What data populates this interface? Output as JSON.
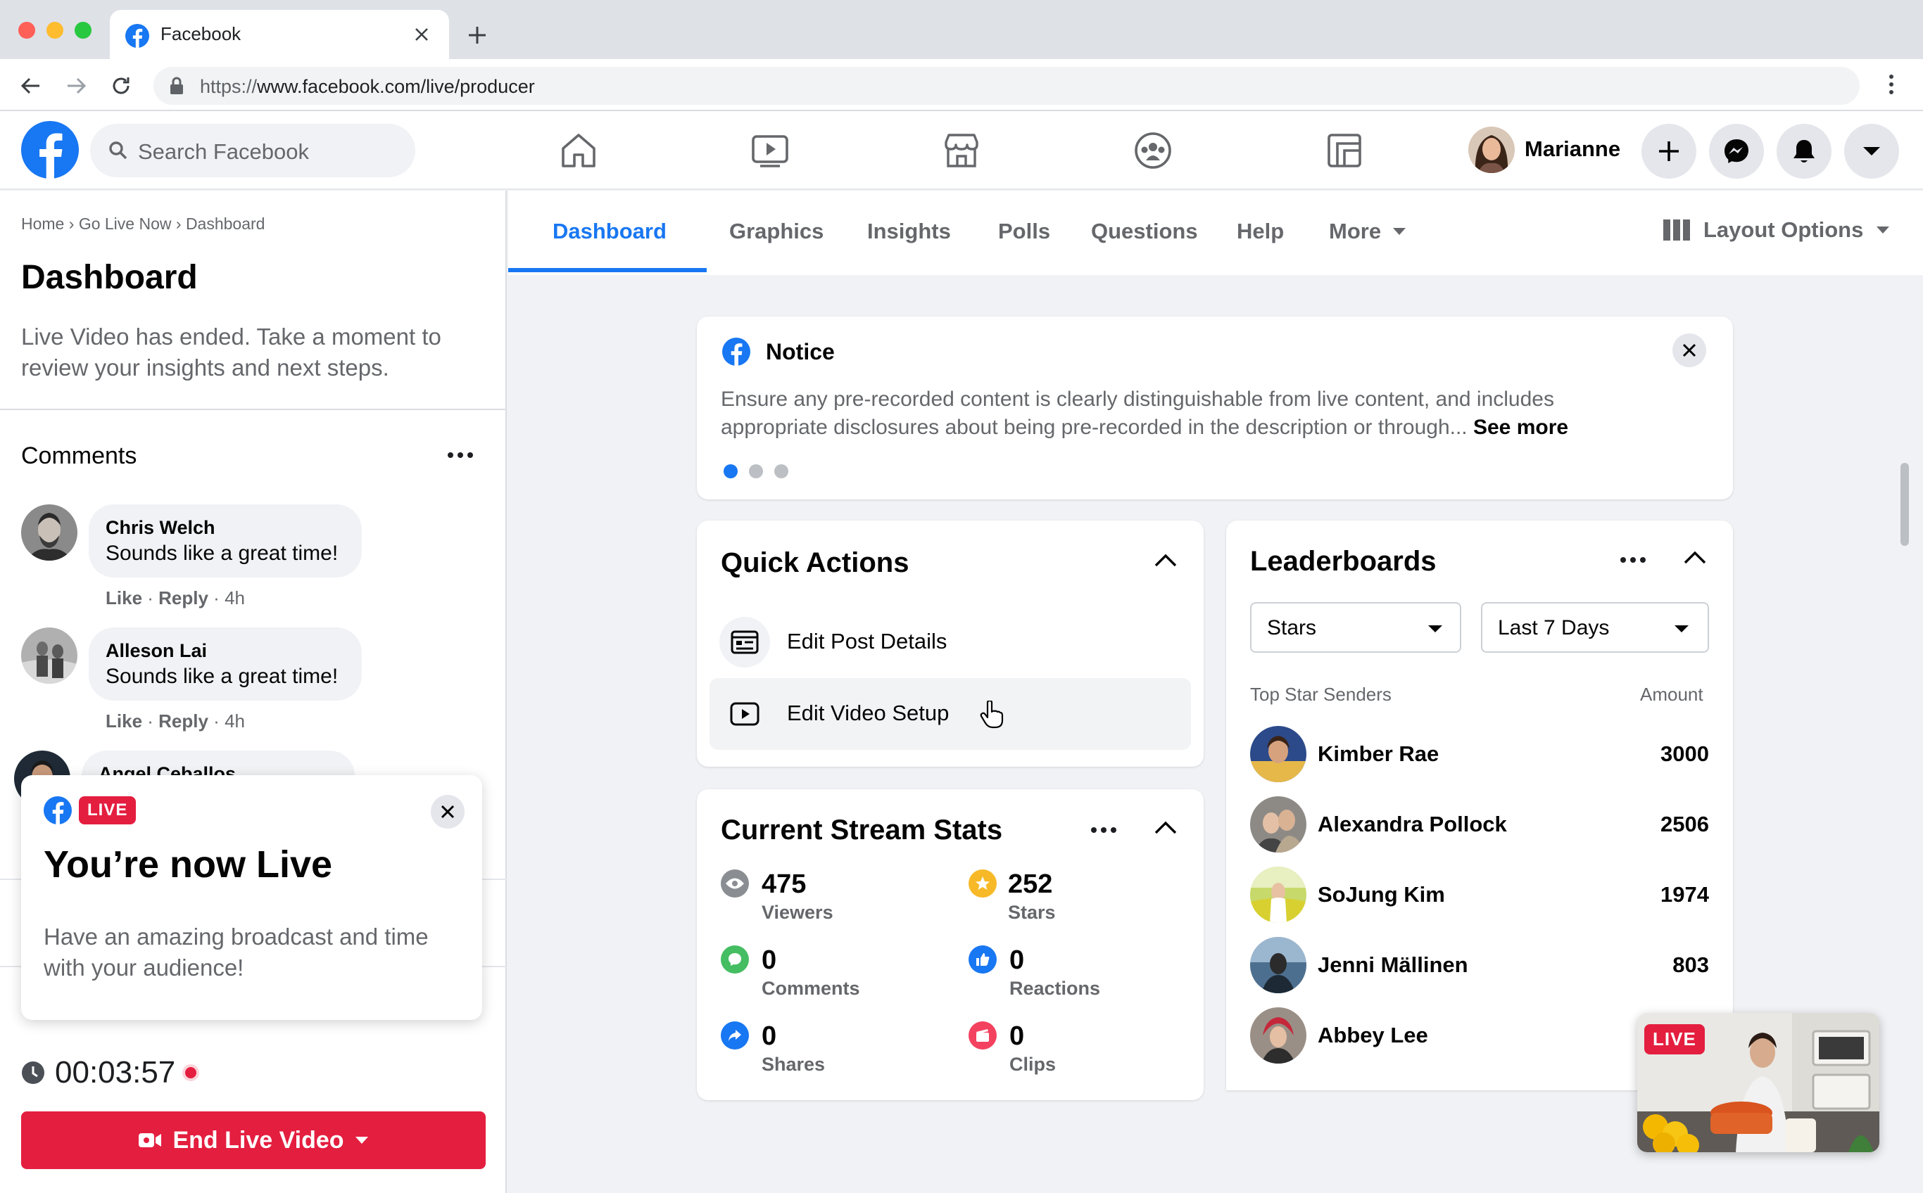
{
  "browser": {
    "tab_title": "Facebook",
    "url_scheme": "https://",
    "url_rest": "www.facebook.com/live/producer",
    "new_tab_icon": "plus-icon",
    "close_tab_icon": "close-icon"
  },
  "fbnav": {
    "search_placeholder": "Search Facebook",
    "user_name": "Marianne",
    "icons": [
      "home-icon",
      "watch-icon",
      "marketplace-icon",
      "groups-icon",
      "gaming-icon"
    ],
    "right_buttons": [
      "create-icon",
      "messenger-icon",
      "notifications-icon",
      "account-menu-icon"
    ]
  },
  "breadcrumb": {
    "home": "Home",
    "sep": "›",
    "go_live": "Go Live Now",
    "current": "Dashboard"
  },
  "left": {
    "title": "Dashboard",
    "description": "Live Video has ended. Take a moment to review your insights and next steps.",
    "comments_title": "Comments",
    "comments": [
      {
        "name": "Chris Welch",
        "text": "Sounds like a great time!",
        "like": "Like",
        "reply": "Reply",
        "time": "4h"
      },
      {
        "name": "Alleson Lai",
        "text": "Sounds like a great time!",
        "like": "Like",
        "reply": "Reply",
        "time": "4h"
      },
      {
        "name": "Angel Ceballos",
        "text": "",
        "like": "",
        "reply": "",
        "time": ""
      }
    ],
    "popup": {
      "badge": "LIVE",
      "title": "You’re now Live",
      "description": "Have an amazing broadcast and time with your audience!"
    },
    "timer": "00:03:57",
    "end_button": "End Live Video"
  },
  "tabs": {
    "items": [
      "Dashboard",
      "Graphics",
      "Insights",
      "Polls",
      "Questions",
      "Help",
      "More"
    ],
    "active": "Dashboard",
    "layout_options": "Layout Options"
  },
  "notice": {
    "title": "Notice",
    "text": "Ensure any pre-recorded content is clearly distinguishable from live content, and includes appropriate disclosures about being pre-recorded in the description or through...",
    "see_more": "See more",
    "pages": 3,
    "active_page": 1
  },
  "quick_actions": {
    "title": "Quick Actions",
    "items": [
      {
        "label": "Edit Post Details",
        "icon": "post-details-icon"
      },
      {
        "label": "Edit Video Setup",
        "icon": "video-setup-icon"
      }
    ]
  },
  "stream_stats": {
    "title": "Current Stream Stats",
    "items": [
      {
        "value": "475",
        "label": "Viewers",
        "icon": "eye-icon",
        "color": "#8a8d91"
      },
      {
        "value": "252",
        "label": "Stars",
        "icon": "star-icon",
        "color": "#f7b928"
      },
      {
        "value": "0",
        "label": "Comments",
        "icon": "comment-icon",
        "color": "#45bd62"
      },
      {
        "value": "0",
        "label": "Reactions",
        "icon": "like-icon",
        "color": "#1877f2"
      },
      {
        "value": "0",
        "label": "Shares",
        "icon": "share-icon",
        "color": "#1877f2"
      },
      {
        "value": "0",
        "label": "Clips",
        "icon": "clip-icon",
        "color": "#f3425f"
      }
    ]
  },
  "leaderboards": {
    "title": "Leaderboards",
    "filter_type": "Stars",
    "filter_range": "Last 7 Days",
    "col_left": "Top Star Senders",
    "col_right": "Amount",
    "rows": [
      {
        "name": "Kimber Rae",
        "amount": "3000"
      },
      {
        "name": "Alexandra Pollock",
        "amount": "2506"
      },
      {
        "name": "SoJung Kim",
        "amount": "1974"
      },
      {
        "name": "Jenni Mällinen",
        "amount": "803"
      },
      {
        "name": "Abbey Lee",
        "amount": ""
      }
    ]
  },
  "pip": {
    "badge": "LIVE"
  },
  "colors": {
    "accent": "#1877f2",
    "live": "#e41e3f"
  }
}
